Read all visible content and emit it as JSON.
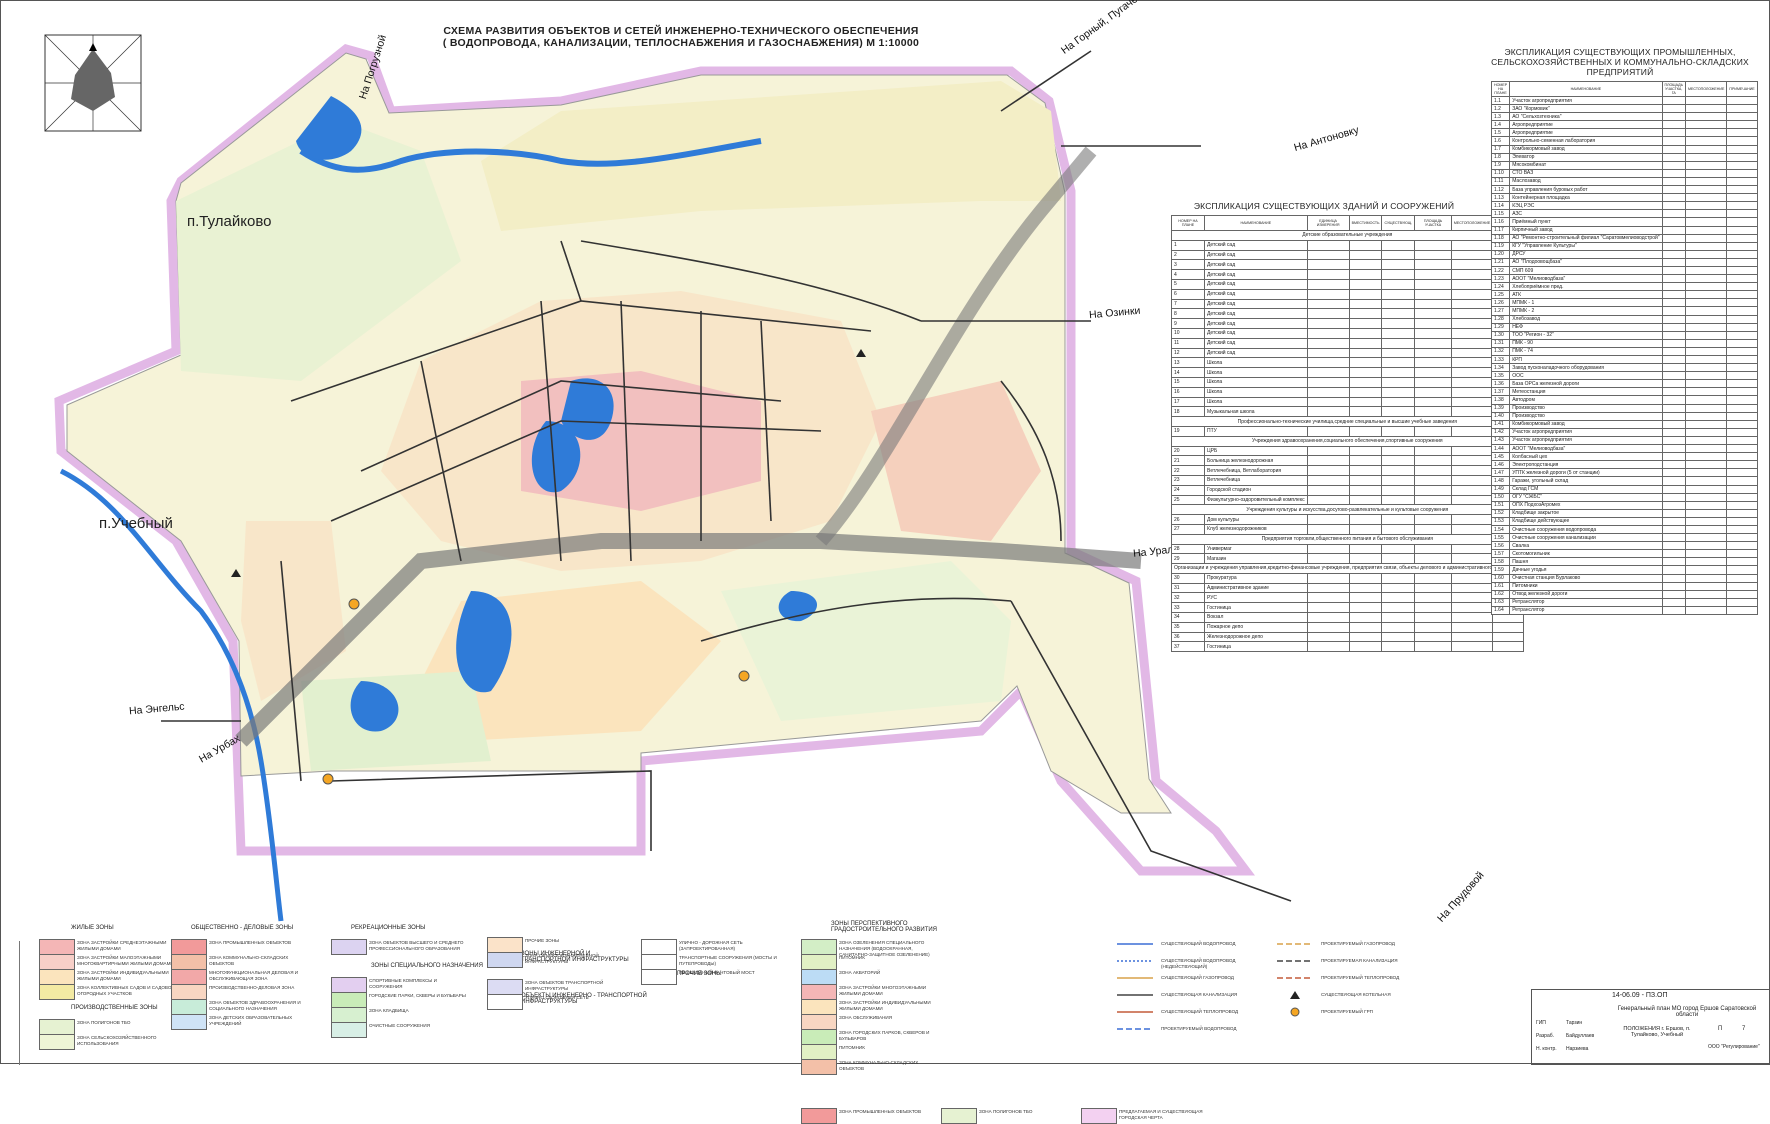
{
  "title": {
    "line1": "СХЕМА РАЗВИТИЯ ОБЪЕКТОВ И СЕТЕЙ ИНЖЕНЕРНО-ТЕХНИЧЕСКОГО ОБЕСПЕЧЕНИЯ",
    "line2": "( ВОДОПРОВОДА, КАНАЛИЗАЦИИ, ТЕПЛОСНАБЖЕНИЯ И ГАЗОСНАБЖЕНИЯ) М 1:10000"
  },
  "places": {
    "tulaikovo": "п.Тулайково",
    "uchebny": "п.Учебный"
  },
  "roads": {
    "gorny": "На Горный, Пугачевск",
    "antonovka": "На Антоновку",
    "ozinki": "На Озинки",
    "uralsk": "На Уральск",
    "engels": "На Энгельс",
    "urbakh": "На Урбах",
    "prudovoi": "На Прудовой",
    "pogruzhnoi": "На Погрузной"
  },
  "table_buildings": {
    "title": "ЭКСПЛИКАЦИЯ СУЩЕСТВУЮЩИХ ЗДАНИЙ И СООРУЖЕНИЙ",
    "columns": [
      "НОМЕР НА ПЛАНЕ",
      "НАИМЕНОВАНИЕ",
      "ЕДИНИЦА ИЗМЕРЕНИЯ",
      "ВМЕСТИМОСТЬ",
      "СУЩЕСТВУЮЩ.",
      "ПЛОЩАДЬ УЧАСТКА",
      "МЕСТОПОЛОЖЕНИЕ",
      "ПРИМЕЧАНИЕ"
    ],
    "rows": [
      {
        "type": "section",
        "text": "Детские образовательные учреждения"
      },
      {
        "n": "1",
        "name": "Детский сад"
      },
      {
        "n": "2",
        "name": "Детский сад"
      },
      {
        "n": "3",
        "name": "Детский сад"
      },
      {
        "n": "4",
        "name": "Детский сад"
      },
      {
        "n": "5",
        "name": "Детский сад"
      },
      {
        "n": "6",
        "name": "Детский сад"
      },
      {
        "n": "7",
        "name": "Детский сад"
      },
      {
        "n": "8",
        "name": "Детский сад"
      },
      {
        "n": "9",
        "name": "Детский сад"
      },
      {
        "n": "10",
        "name": "Детский сад"
      },
      {
        "n": "11",
        "name": "Детский сад"
      },
      {
        "n": "12",
        "name": "Детский сад"
      },
      {
        "n": "13",
        "name": "Школа"
      },
      {
        "n": "14",
        "name": "Школа"
      },
      {
        "n": "15",
        "name": "Школа"
      },
      {
        "n": "16",
        "name": "Школа"
      },
      {
        "n": "17",
        "name": "Школа"
      },
      {
        "n": "18",
        "name": "Музыкальная школа"
      },
      {
        "type": "section",
        "text": "Профессионально-технические училища,средние специальные и высшие учебные заведения"
      },
      {
        "n": "19",
        "name": "ПТУ"
      },
      {
        "type": "section",
        "text": "Учреждения здравоохранения,социального обеспечения,спортивные сооружения"
      },
      {
        "n": "20",
        "name": "ЦРБ"
      },
      {
        "n": "21",
        "name": "Больница железнодорожная"
      },
      {
        "n": "22",
        "name": "Ветлечебница, Ветлаборатория"
      },
      {
        "n": "23",
        "name": "Ветлечебница"
      },
      {
        "n": "24",
        "name": "Городской стадион"
      },
      {
        "n": "25",
        "name": "Физкультурно-оздоровительный комплекс"
      },
      {
        "type": "section",
        "text": "Учреждения культуры и искусства,досугово-развлекательные и культовые сооружения"
      },
      {
        "n": "26",
        "name": "Дом культуры"
      },
      {
        "n": "27",
        "name": "Клуб железнодорожников"
      },
      {
        "type": "section",
        "text": "Предприятия торговли,общественного питания и бытового обслуживания"
      },
      {
        "n": "28",
        "name": "Универмаг"
      },
      {
        "n": "29",
        "name": "Магазин"
      },
      {
        "type": "section",
        "text": "Организации и учреждения управления,кредитно-финансовые учреждения, предприятия связи, объекты делового и административного назначения"
      },
      {
        "n": "30",
        "name": "Прокуратура"
      },
      {
        "n": "31",
        "name": "Административное здание"
      },
      {
        "n": "32",
        "name": "РУС"
      },
      {
        "n": "33",
        "name": "Гостиница"
      },
      {
        "n": "34",
        "name": "Вокзал"
      },
      {
        "n": "35",
        "name": "Пожарное депо"
      },
      {
        "n": "36",
        "name": "Железнодорожное депо"
      },
      {
        "n": "37",
        "name": "Гостиница"
      }
    ]
  },
  "table_industry": {
    "title": "ЭКСПЛИКАЦИЯ СУЩЕСТВУЮЩИХ ПРОМЫШЛЕННЫХ, СЕЛЬСКОХОЗЯЙСТВЕННЫХ И КОММУНАЛЬНО-СКЛАДСКИХ ПРЕДПРИЯТИЙ",
    "columns": [
      "НОМЕР НА ПЛАНЕ",
      "НАИМЕНОВАНИЕ",
      "ПЛОЩАДЬ УЧАСТКА, ГА",
      "МЕСТОПОЛОЖЕНИЕ",
      "ПРИМЕЧАНИЕ"
    ],
    "rows": [
      {
        "n": "1.1",
        "name": "Участок агропредприятия"
      },
      {
        "n": "1.2",
        "name": "ЗАО \"Кормовик\""
      },
      {
        "n": "1.3",
        "name": "АО \"Сельхозтехника\""
      },
      {
        "n": "1.4",
        "name": "Агропредприятие"
      },
      {
        "n": "1.5",
        "name": "Агропредприятие"
      },
      {
        "n": "1.6",
        "name": "Контрольно-семенная лаборатория"
      },
      {
        "n": "1.7",
        "name": "Комбикормовый завод"
      },
      {
        "n": "1.8",
        "name": "Элеватор"
      },
      {
        "n": "1.9",
        "name": "Мясокомбинат"
      },
      {
        "n": "1.10",
        "name": "СТО ВАЗ"
      },
      {
        "n": "1.11",
        "name": "Маслозавод"
      },
      {
        "n": "1.12",
        "name": "База управления буровых работ"
      },
      {
        "n": "1.13",
        "name": "Контейнерная площадка"
      },
      {
        "n": "1.14",
        "name": "КЭЦ РЭС"
      },
      {
        "n": "1.15",
        "name": "АЗС"
      },
      {
        "n": "1.16",
        "name": "Приёмный пункт"
      },
      {
        "n": "1.17",
        "name": "Кирпичный завод"
      },
      {
        "n": "1.18",
        "name": "АО \"Ремонтно-строительный филиал \"Саратовмелиоводстрой\""
      },
      {
        "n": "1.19",
        "name": "КГУ \"Управление Культуры\""
      },
      {
        "n": "1.20",
        "name": "ДРСУ"
      },
      {
        "n": "1.21",
        "name": "АО \"Плодоовощбаза\""
      },
      {
        "n": "1.22",
        "name": "СМП 609"
      },
      {
        "n": "1.23",
        "name": "АООТ \"Мелиоводбаза\""
      },
      {
        "n": "1.24",
        "name": "Хлебоприёмное пред."
      },
      {
        "n": "1.25",
        "name": "АТК"
      },
      {
        "n": "1.26",
        "name": "МПМК - 1"
      },
      {
        "n": "1.27",
        "name": "МПМК - 2"
      },
      {
        "n": "1.28",
        "name": "Хлебозавод"
      },
      {
        "n": "1.29",
        "name": "НЕФ"
      },
      {
        "n": "1.30",
        "name": "ТОО \"Регион - 32\""
      },
      {
        "n": "1.31",
        "name": "ПМК - 90"
      },
      {
        "n": "1.32",
        "name": "ПМК - 74"
      },
      {
        "n": "1.33",
        "name": "КРП"
      },
      {
        "n": "1.34",
        "name": "Завод пусконаладочного оборудования"
      },
      {
        "n": "1.35",
        "name": "ООС"
      },
      {
        "n": "1.36",
        "name": "База ОРСа железной дороги"
      },
      {
        "n": "1.37",
        "name": "Метеостанция"
      },
      {
        "n": "1.38",
        "name": "Автодром"
      },
      {
        "n": "1.39",
        "name": "Производство"
      },
      {
        "n": "1.40",
        "name": "Производство"
      },
      {
        "n": "1.41",
        "name": "Комбикормовый завод"
      },
      {
        "n": "1.42",
        "name": "Участок агропредприятия"
      },
      {
        "n": "1.43",
        "name": "Участок агропредприятия"
      },
      {
        "n": "1.44",
        "name": "АООТ \"Мелиоводбаза\""
      },
      {
        "n": "1.45",
        "name": "Колбасный цех"
      },
      {
        "n": "1.46",
        "name": "Электроподстанция"
      },
      {
        "n": "1.47",
        "name": "УПТК железной дороги (5 от станции)"
      },
      {
        "n": "1.48",
        "name": "Гаражи, угольный склад"
      },
      {
        "n": "1.49",
        "name": "Склад ГСМ"
      },
      {
        "n": "1.50",
        "name": "ОГУ \"СЖБС\""
      },
      {
        "n": "1.51",
        "name": "ОПХ ПодхозАгромех"
      },
      {
        "n": "1.52",
        "name": "Кладбище закрытое"
      },
      {
        "n": "1.53",
        "name": "Кладбище действующее"
      },
      {
        "n": "1.54",
        "name": "Очистные сооружения водопровода"
      },
      {
        "n": "1.55",
        "name": "Очистные сооружения канализации"
      },
      {
        "n": "1.56",
        "name": "Свалка"
      },
      {
        "n": "1.57",
        "name": "Скотомогильник"
      },
      {
        "n": "1.58",
        "name": "Пашня"
      },
      {
        "n": "1.59",
        "name": "Дачные угодья"
      },
      {
        "n": "1.60",
        "name": "Очистная станция Бурлаково"
      },
      {
        "n": "1.61",
        "name": "Питомники"
      },
      {
        "n": "1.62",
        "name": "Отвод железной дороги"
      },
      {
        "n": "1.63",
        "name": "Ретранслятор"
      },
      {
        "n": "1.64",
        "name": "Ретранслятор"
      }
    ]
  },
  "legend": {
    "groups": {
      "residential": "ЖИЛЫЕ ЗОНЫ",
      "public": "ОБЩЕСТВЕННО - ДЕЛОВЫЕ ЗОНЫ",
      "recreation": "РЕКРЕАЦИОННЫЕ ЗОНЫ",
      "special": "ЗОНЫ СПЕЦИАЛЬНОГО НАЗНАЧЕНИЯ",
      "industrial": "ПРОИЗВОДСТВЕННЫЕ ЗОНЫ",
      "engineering": "ЗОНЫ ИНЖЕНЕРНОЙ И ТРАНСПОРТНОЙ ИНФРАСТРУКТУРЫ",
      "objects": "ОБЪЕКТЫ ИНЖЕНЕРНО - ТРАНСПОРТНОЙ ИНФРАСТРУКТУРЫ",
      "other": "ПРОЧИЕ ЗОНЫ",
      "prospective": "ЗОНЫ ПЕРСПЕКТИВНОГО ГРАДОСТРОИТЕЛЬНОГО РАЗВИТИЯ"
    },
    "items": [
      {
        "text": "ЗОНА ЗАСТРОЙКИ СРЕДНЕЭТАЖНЫМИ ЖИЛЫМИ ДОМАМИ",
        "color": "#f4b6b6"
      },
      {
        "text": "ЗОНА ЗАСТРОЙКИ МАЛОЭТАЖНЫМИ МНОГОКВАРТИРНЫМИ ЖИЛЫМИ ДОМАМИ",
        "color": "#f7cfc8"
      },
      {
        "text": "ЗОНА ЗАСТРОЙКИ ИНДИВИДУАЛЬНЫМИ ЖИЛЫМИ ДОМАМИ",
        "color": "#fbe4bd"
      },
      {
        "text": "ЗОНА КОЛЛЕКТИВНЫХ САДОВ И САДОВО-ОГОРОДНЫХ УЧАСТКОВ",
        "color": "#f3eaa3"
      },
      {
        "text": "ЗОНА ПРОМЫШЛЕННЫХ ОБЪЕКТОВ",
        "color": "#f29a9a"
      },
      {
        "text": "ЗОНА КОММУНАЛЬНО-СКЛАДСКИХ ОБЪЕКТОВ",
        "color": "#f3c0a8"
      },
      {
        "text": "МНОГОФУНКЦИОНАЛЬНАЯ ДЕЛОВАЯ И ОБСЛУЖИВАЮЩАЯ ЗОНА",
        "color": "#f2a8a8"
      },
      {
        "text": "ПРОИЗВОДСТВЕННО-ДЕЛОВАЯ ЗОНА",
        "color": "#f8d6c2"
      },
      {
        "text": "ЗОНА ОБЪЕКТОВ ЗДРАВООХРАНЕНИЯ И СОЦИАЛЬНОГО НАЗНАЧЕНИЯ",
        "color": "#c8ecd9"
      },
      {
        "text": "ЗОНА ДЕТСКИХ ОБРАЗОВАТЕЛЬНЫХ УЧРЕЖДЕНИЙ",
        "color": "#cfe3f6"
      },
      {
        "text": "ЗОНА ОБЪЕКТОВ ВЫСШЕГО И СРЕДНЕГО ПРОФЕССИОНАЛЬНОГО ОБРАЗОВАНИЯ",
        "color": "#dcd3f1"
      },
      {
        "text": "СПОРТИВНЫЕ КОМПЛЕКСЫ И СООРУЖЕНИЯ",
        "color": "#e3cff0"
      },
      {
        "text": "ГОРОДСКИЕ ПАРКИ, СКВЕРЫ И БУЛЬВАРЫ",
        "color": "#c9ecb8"
      },
      {
        "text": "ЗОНА КЛАДБИЩА",
        "color": "#d7f0d0"
      },
      {
        "text": "ОЧИСТНЫЕ СООРУЖЕНИЯ",
        "color": "#d8efe6"
      },
      {
        "text": "ЗОНА ПОЛИГОНОВ ТБО",
        "color": "#e6f2d2"
      },
      {
        "text": "ЗОНА СЕЛЬСКОХОЗЯЙСТВЕННОГО ИСПОЛЬЗОВАНИЯ",
        "color": "#eef5d6"
      },
      {
        "text": "ПРОЧИЕ ЗОНЫ",
        "color": "#fbe3c9"
      },
      {
        "text": "ЗОНА ОБЪЕКТОВ ИНЖЕНЕРНОЙ ИНФРАСТРУКТУРЫ",
        "color": "#cfd7f0"
      },
      {
        "text": "ЗОНА ОБЪЕКТОВ ТРАНСПОРТНОЙ ИНФРАСТРУКТУРЫ",
        "color": "#dcdcf3"
      },
      {
        "text": "УЛИЧНО - ДОРОЖНАЯ СЕТЬ",
        "color": "#ffffff"
      },
      {
        "text": "УЛИЧНО - ДОРОЖНАЯ СЕТЬ (ЗАПРОЕКТИРОВАННАЯ)",
        "color": "#ffffff"
      },
      {
        "text": "ТРАНСПОРТНЫЕ СООРУЖЕНИЯ (МОСТЫ И ПУТЕПРОВОДЫ)",
        "color": "#ffffff"
      },
      {
        "text": "ПЕШЕХОДНЫЙ ВАНТОВЫЙ МОСТ",
        "color": "#ffffff"
      },
      {
        "text": "ЗОНА ОЗЕЛЕНЕНИЯ СПЕЦИАЛЬНОГО НАЗНАЧЕНИЯ (ВОДООХРАННАЯ, САНИТАРНО-ЗАЩИТНОЕ ОЗЕЛЕНЕНИЕ)",
        "color": "#d3eec6"
      },
      {
        "text": "ПИТОМНИК",
        "color": "#e1f0c4"
      },
      {
        "text": "ЗОНА АКВАТОРИЙ",
        "color": "#bcdcf5"
      },
      {
        "text": "ЗОНА ЗАСТРОЙКИ МНОГОЭТАЖНЫМИ ЖИЛЫМИ ДОМАМИ",
        "color": "#f4b6b6"
      },
      {
        "text": "ЗОНА ЗАСТРОЙКИ ИНДИВИДУАЛЬНЫМИ ЖИЛЫМИ ДОМАМИ",
        "color": "#fbe4bd"
      },
      {
        "text": "ЗОНА ОБСЛУЖИВАНИЯ",
        "color": "#f8d6c2"
      },
      {
        "text": "ЗОНА ГОРОДСКИХ ПАРКОВ, СКВЕРОВ И БУЛЬВАРОВ",
        "color": "#c9ecb8"
      },
      {
        "text": "ПИТОМНИК",
        "color": "#e1f0c4"
      },
      {
        "text": "ЗОНА КОММУНАЛЬНО-СКЛАДСКИХ ОБЪЕКТОВ",
        "color": "#f3c0a8"
      },
      {
        "text": "ЗОНА ПРОМЫШЛЕННЫХ ОБЪЕКТОВ",
        "color": "#f29a9a"
      },
      {
        "text": "ЗОНА ПОЛИГОНОВ ТБО",
        "color": "#e6f2d2"
      },
      {
        "text": "ПРЕДЛАГАЕМАЯ И СУЩЕСТВУЮЩАЯ ГОРОДСКАЯ ЧЕРТА",
        "color": "#f3d1f1"
      }
    ],
    "lines": [
      {
        "text": "СУЩЕСТВУЮЩИЙ ВОДОПРОВОД",
        "color": "#3b6fd6",
        "dash": ""
      },
      {
        "text": "СУЩЕСТВУЮЩИЙ ВОДОПРОВОД (НЕДЕЙСТВУЮЩИЙ)",
        "color": "#3b6fd6",
        "dash": "2,2"
      },
      {
        "text": "СУЩЕСТВУЮЩИЙ ГАЗОПРОВОД",
        "color": "#d9a24a",
        "dash": ""
      },
      {
        "text": "СУЩЕСТВУЮЩАЯ КАНАЛИЗАЦИЯ",
        "color": "#444444",
        "dash": ""
      },
      {
        "text": "СУЩЕСТВУЮЩИЙ ТЕПЛОПРОВОД",
        "color": "#c45b3a",
        "dash": ""
      },
      {
        "text": "ПРОЕКТИРУЕМЫЙ ВОДОПРОВОД",
        "color": "#3b6fd6",
        "dash": "6,3"
      },
      {
        "text": "ПРОЕКТИРУЕМЫЙ ГАЗОПРОВОД",
        "color": "#d9a24a",
        "dash": "6,3"
      },
      {
        "text": "ПРОЕКТИРУЕМАЯ КАНАЛИЗАЦИЯ",
        "color": "#444444",
        "dash": "6,3"
      },
      {
        "text": "ПРОЕКТИРУЕМЫЙ ТЕПЛОПРОВОД",
        "color": "#c45b3a",
        "dash": "6,3"
      },
      {
        "text": "СУЩЕСТВУЮЩАЯ КОТЕЛЬНАЯ",
        "color": "#222222",
        "dash": "marker-triangle"
      },
      {
        "text": "ПРОЕКТИРУЕМЫЙ ГРП",
        "color": "#f5a623",
        "dash": "marker-circle"
      }
    ]
  },
  "titleblock": {
    "code": "14-06.09 - ПЗ.ОП",
    "project": "Генеральный план МО город Ершов Саратовской области",
    "subject": "ПОЛОЖЕНИЯ г. Ершов, п. Тулайково, Учебный",
    "stage": "П",
    "sheet": "7",
    "org": "ООО \"Регулирование\"",
    "roles": [
      "ГИП",
      "Разраб.",
      "Н. контр."
    ],
    "names": [
      "Тарзин",
      "Байдуллаев",
      "Нарзиева"
    ]
  }
}
